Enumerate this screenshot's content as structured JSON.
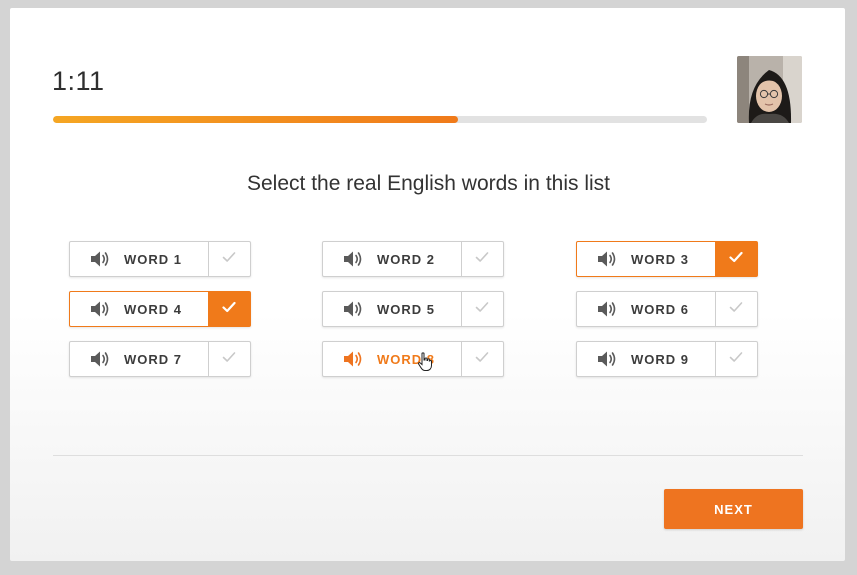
{
  "timer": {
    "text": "1:11"
  },
  "progress": {
    "fraction": 0.62
  },
  "prompt": {
    "text": "Select the real English words in this list"
  },
  "words": [
    {
      "label": "WORD 1",
      "selected": false
    },
    {
      "label": "WORD 2",
      "selected": false
    },
    {
      "label": "WORD 3",
      "selected": true
    },
    {
      "label": "WORD 4",
      "selected": true
    },
    {
      "label": "WORD 5",
      "selected": false
    },
    {
      "label": "WORD 6",
      "selected": false
    },
    {
      "label": "WORD 7",
      "selected": false
    },
    {
      "label": "WORD 8",
      "selected": false,
      "hovered": true
    },
    {
      "label": "WORD 9",
      "selected": false
    }
  ],
  "next_button": {
    "label": "NEXT"
  },
  "colors": {
    "accent": "#ee7420",
    "text": "#3c3c3c",
    "check_idle": "#c8c8c8"
  },
  "icons": {
    "word_audio": "speaker-icon",
    "word_check": "checkmark-icon",
    "cursor": "hand-pointer-icon"
  }
}
